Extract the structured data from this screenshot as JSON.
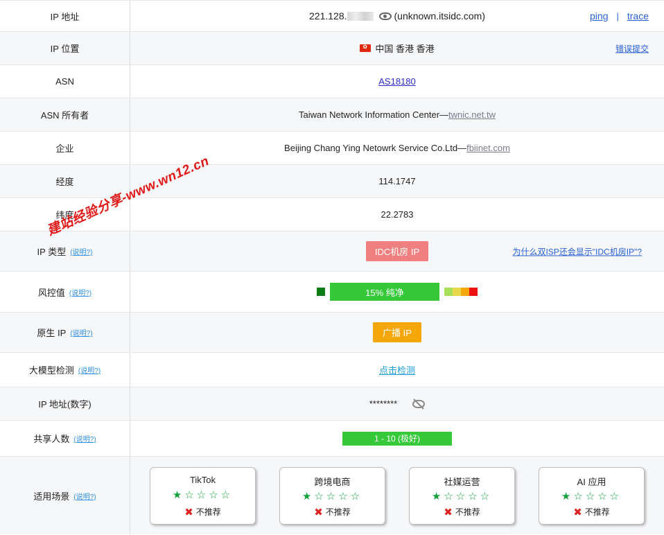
{
  "rows": {
    "ip": {
      "label": "IP 地址",
      "address": "221.128.",
      "hostname": "(unknown.itsidc.com)",
      "ping": "ping",
      "sep": "|",
      "trace": "trace"
    },
    "location": {
      "label": "IP 位置",
      "value": "中国 香港 香港",
      "report": "错误提交"
    },
    "asn": {
      "label": "ASN",
      "value": "AS18180"
    },
    "asn_owner": {
      "label": "ASN 所有者",
      "value": "Taiwan Network Information Center—",
      "domain": "twnic.net.tw"
    },
    "company": {
      "label": "企业",
      "value": "Beijing Chang Ying Netowrk Service Co.Ltd—",
      "domain": "fbiinet.com"
    },
    "longitude": {
      "label": "经度",
      "value": "114.1747"
    },
    "latitude": {
      "label": "纬度",
      "value": "22.2783"
    },
    "ip_type": {
      "label": "IP 类型",
      "help": "(说明?)",
      "badge": "IDC机房 IP",
      "why": "为什么双ISP还会显示\"IDC机房IP\"?"
    },
    "risk": {
      "label": "风控值",
      "help": "(说明?)",
      "bar": "15%   纯净",
      "percent": 15
    },
    "native": {
      "label": "原生 IP",
      "help": "(说明?)",
      "badge": "广播 IP"
    },
    "ai_check": {
      "label": "大模型检测",
      "help": "(说明?)",
      "link": "点击检测"
    },
    "ip_number": {
      "label": "IP 地址(数字)",
      "value": "********"
    },
    "shared": {
      "label": "共享人数",
      "help": "(说明?)",
      "bar": "1 - 10 (极好)"
    },
    "scenarios": {
      "label": "适用场景",
      "help": "(说明?)",
      "cards": [
        {
          "title": "TikTok",
          "stars": "★☆☆☆☆",
          "rating": 1,
          "verdict": "不推荐"
        },
        {
          "title": "跨境电商",
          "stars": "★☆☆☆☆",
          "rating": 1,
          "verdict": "不推荐"
        },
        {
          "title": "社媒运营",
          "stars": "★☆☆☆☆",
          "rating": 1,
          "verdict": "不推荐"
        },
        {
          "title": "AI 应用",
          "stars": "★☆☆☆☆",
          "rating": 1,
          "verdict": "不推荐"
        }
      ]
    }
  },
  "watermark": "建站经验分享-www.wn12.cn",
  "colors": {
    "link": "#2860d8",
    "idc_badge": "#f08080",
    "broadcast_badge": "#f5a70a",
    "clean_green": "#35c93a",
    "risk_scale": [
      "#a6e05a",
      "#e8d84a",
      "#f5a70a",
      "#ee1111"
    ],
    "star": "#12a13a",
    "watermark": "#e01919"
  },
  "icons": {
    "ip_eye": "eye-icon",
    "number_hidden": "eye-off-icon",
    "flag": "hong-kong-flag-icon",
    "verdict": "x-mark-icon",
    "star": "star-icon"
  }
}
